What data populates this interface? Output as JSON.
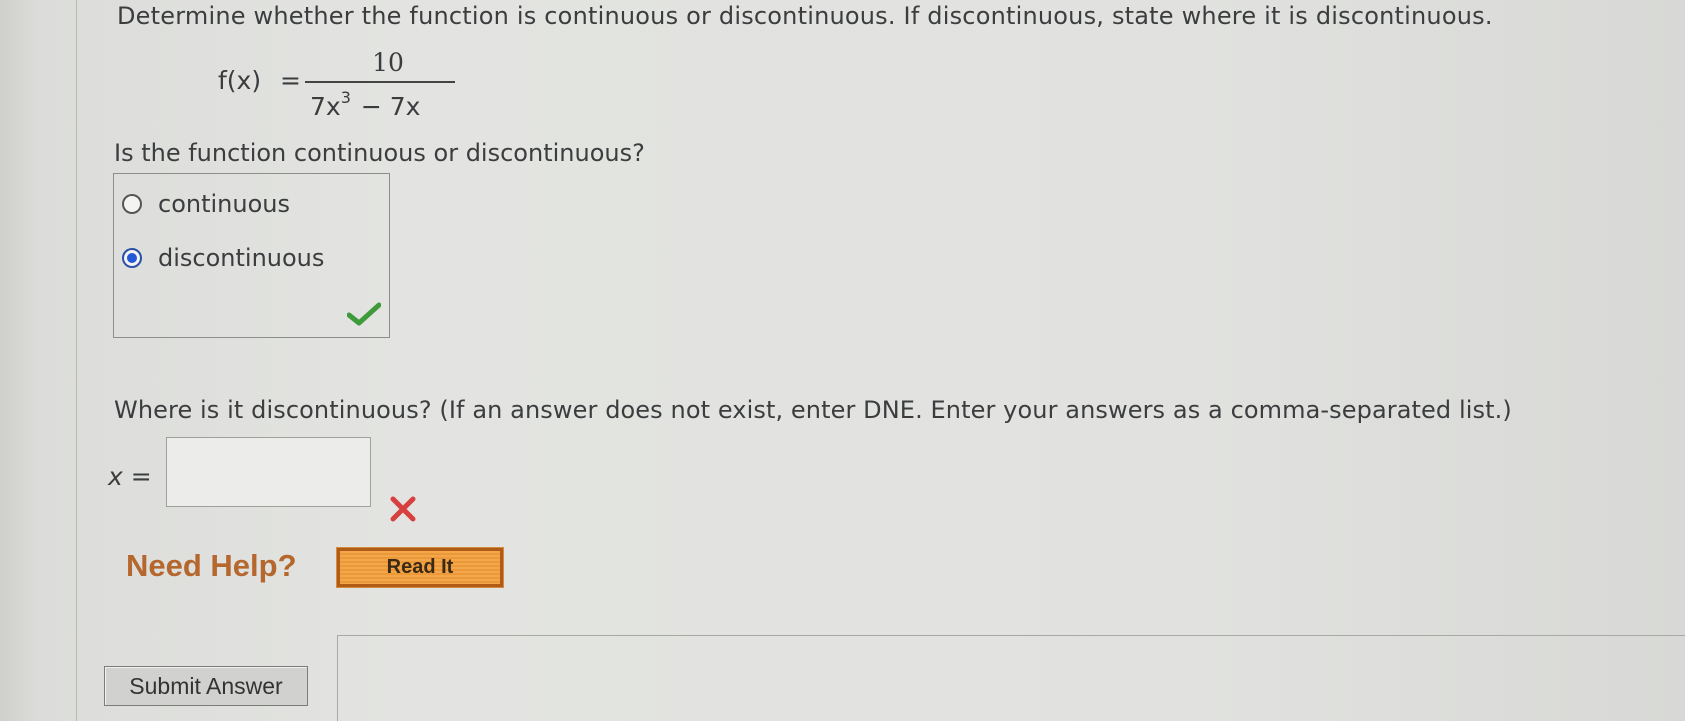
{
  "question": {
    "text": "Determine whether the function is continuous or discontinuous. If discontinuous, state where it is discontinuous."
  },
  "formula": {
    "lhs": "f(x)",
    "equals": "=",
    "numerator": "10",
    "denominator_a": "7x",
    "denominator_exp": "3",
    "denominator_b": "− 7x"
  },
  "part1": {
    "prompt": "Is the function continuous or discontinuous?",
    "options": [
      {
        "label": "continuous",
        "selected": false
      },
      {
        "label": "discontinuous",
        "selected": true
      }
    ],
    "status": "correct"
  },
  "part2": {
    "prompt": "Where is it discontinuous? (If an answer does not exist, enter DNE. Enter your answers as a comma-separated list.)",
    "variable_label": "x =",
    "input_value": "",
    "status": "incorrect"
  },
  "help": {
    "label": "Need Help?",
    "read_it_label": "Read It"
  },
  "submit_label": "Submit Answer",
  "colors": {
    "correct": "#3f9a3a",
    "incorrect": "#d84040",
    "help_text": "#b5672d",
    "read_it_bg": "#f0a040",
    "radio_selected": "#2358d8"
  }
}
